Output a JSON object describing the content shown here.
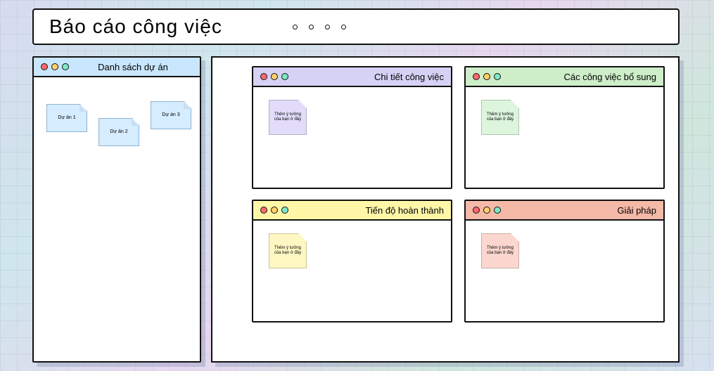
{
  "title": "Báo cáo công việc",
  "projects_window": {
    "title": "Danh sách dự án",
    "items": [
      "Dự án 1",
      "Dự án  2",
      "Dự án 3"
    ]
  },
  "note_text": "Thêm ý tưởng của bạn ở đây",
  "panels": {
    "detail": {
      "title": "Chi tiết công việc"
    },
    "addwork": {
      "title": "Các công việc bổ sung"
    },
    "progress": {
      "title": "Tiến độ hoàn thành"
    },
    "solution": {
      "title": "Giải pháp"
    }
  }
}
